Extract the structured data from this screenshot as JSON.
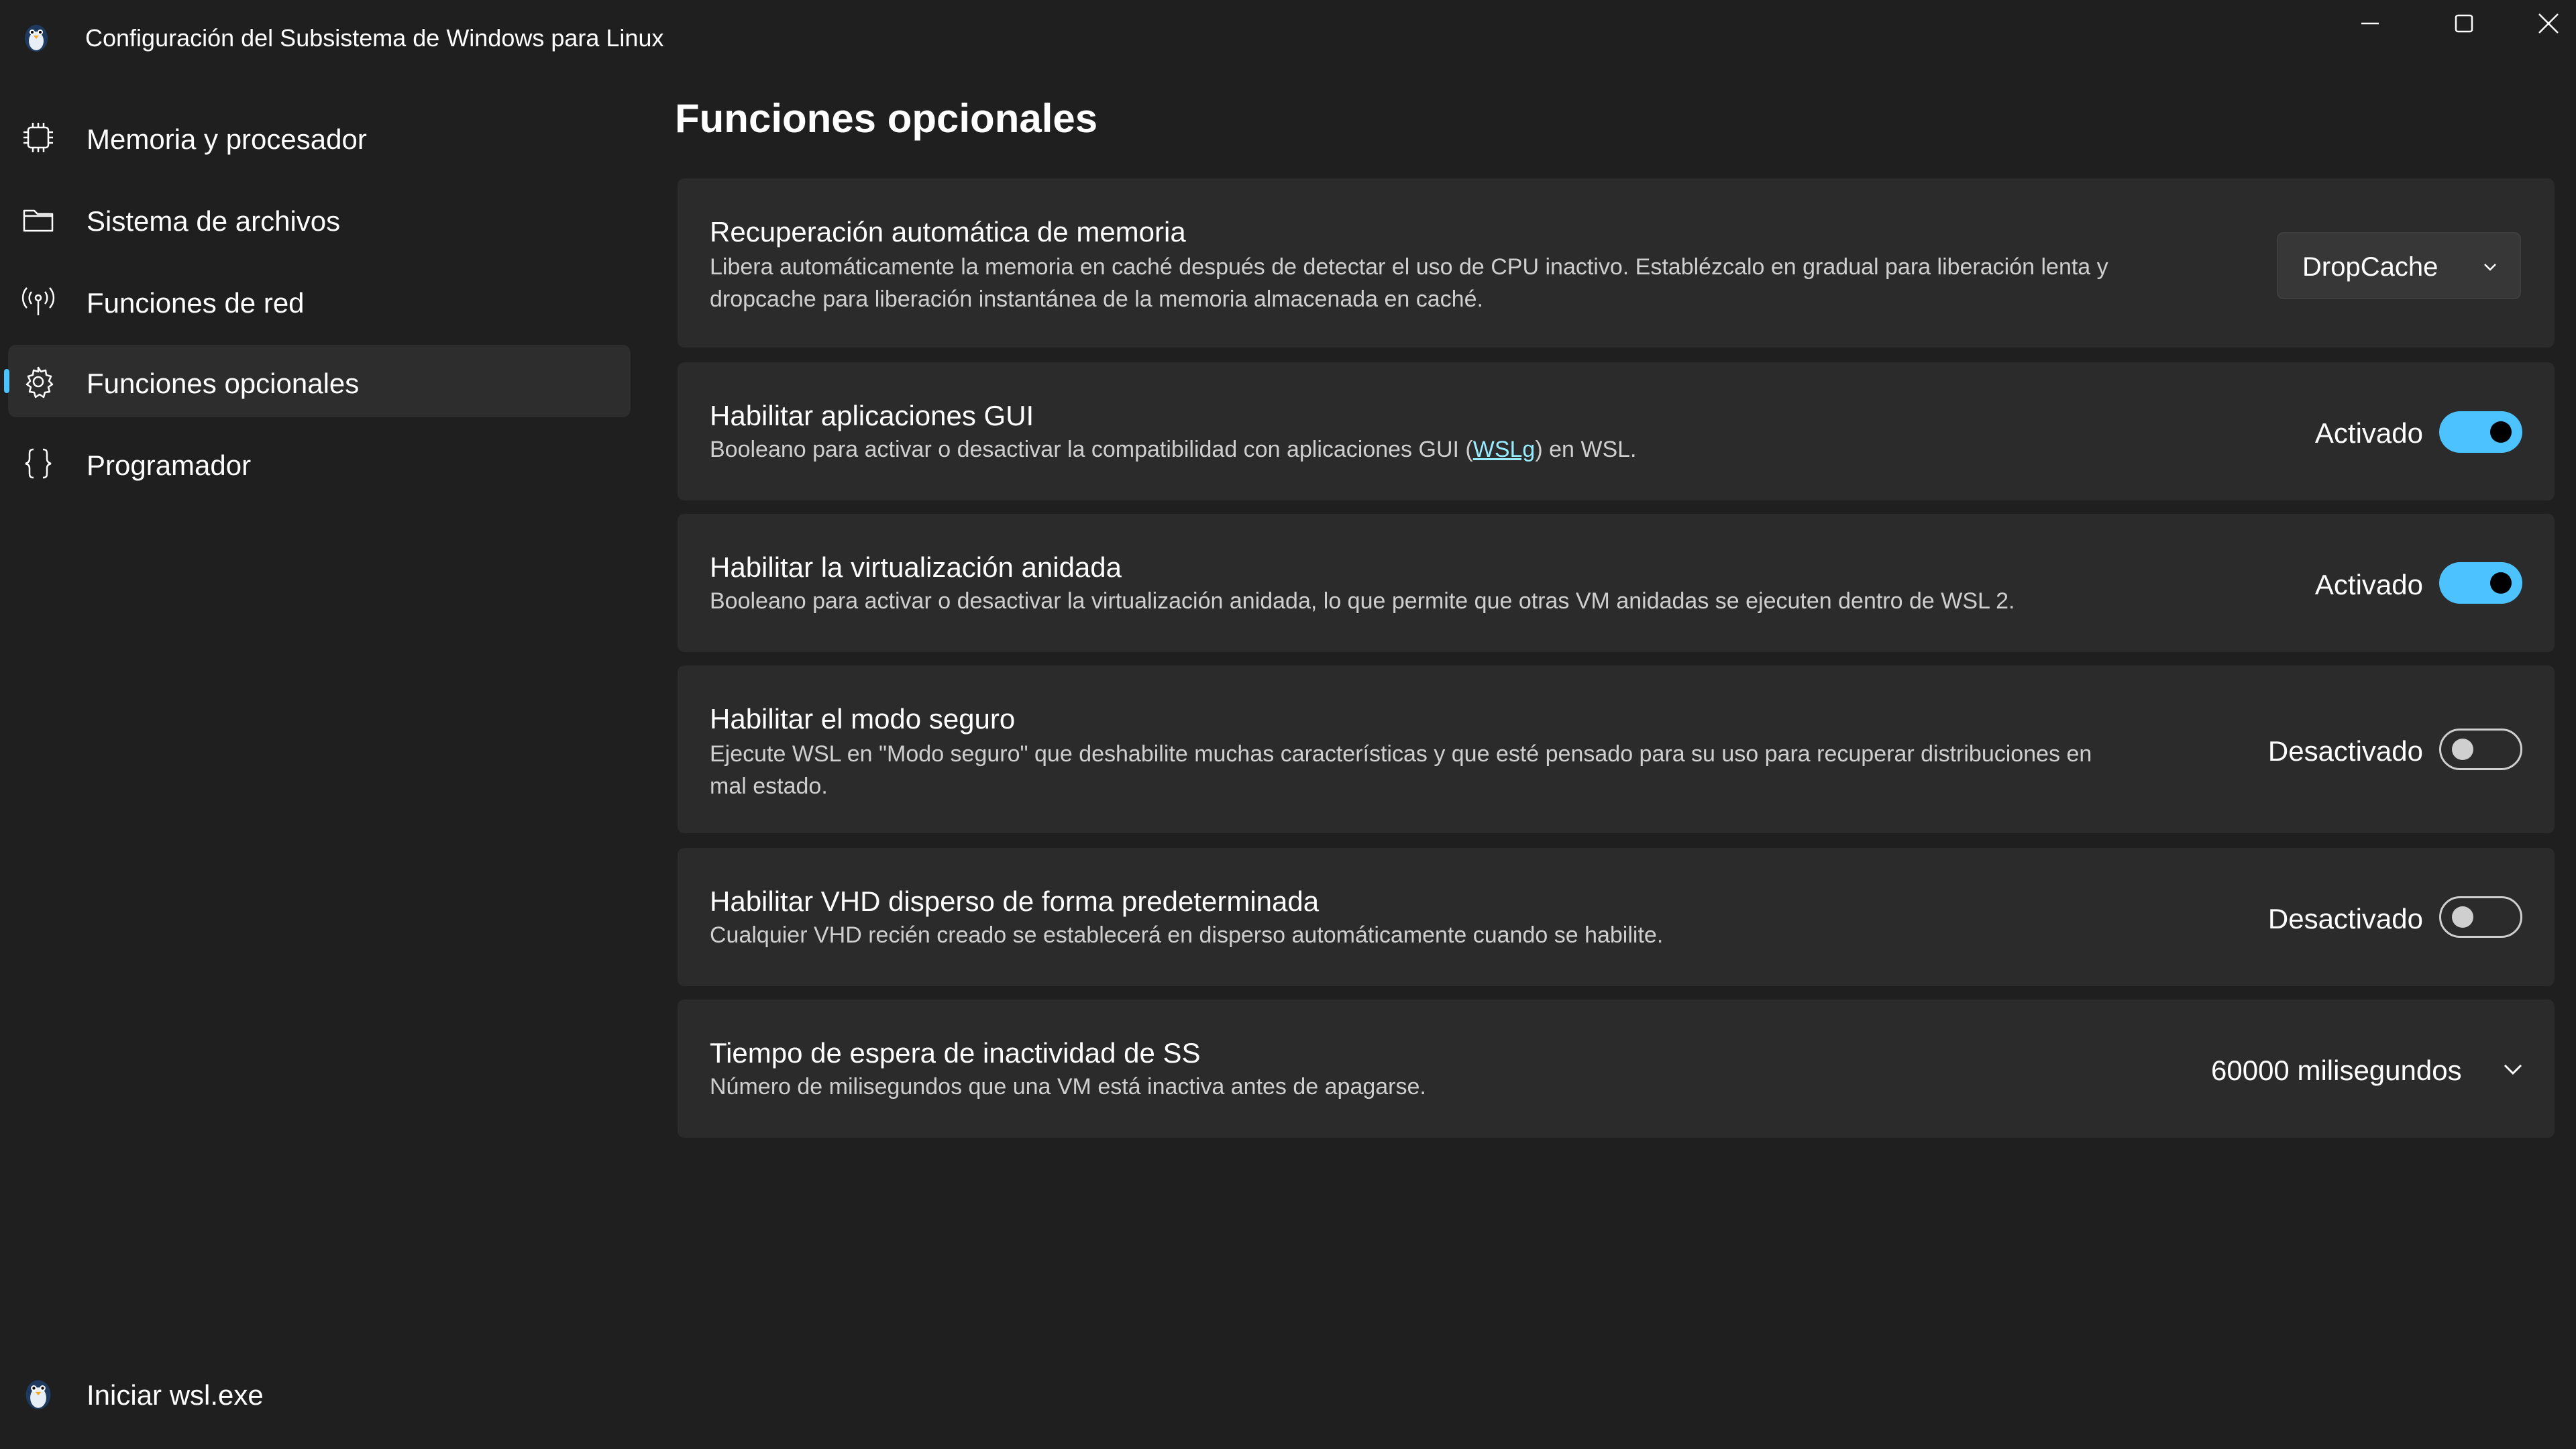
{
  "window": {
    "title": "Configuración del Subsistema de Windows para Linux",
    "icon": "penguin-icon"
  },
  "sidebar": {
    "items": [
      {
        "label": "Memoria y procesador",
        "icon": "chip-icon"
      },
      {
        "label": "Sistema de archivos",
        "icon": "folder-icon"
      },
      {
        "label": "Funciones de red",
        "icon": "network-icon"
      },
      {
        "label": "Funciones opcionales",
        "icon": "gear-icon",
        "selected": true
      },
      {
        "label": "Programador",
        "icon": "braces-icon"
      }
    ],
    "footer": {
      "label": "Iniciar wsl.exe",
      "icon": "penguin-icon"
    }
  },
  "main": {
    "title": "Funciones opcionales",
    "settings": [
      {
        "title": "Recuperación automática de memoria",
        "description_line1": "Libera automáticamente la memoria en caché después de detectar el uso de CPU inactivo. Establézcalo en gradual para liberación lenta y",
        "description_line2": "dropcache para liberación instantánea de la memoria almacenada en caché.",
        "control": "dropdown",
        "value": "DropCache"
      },
      {
        "title": "Habilitar aplicaciones GUI",
        "description_before": "Booleano para activar o desactivar la compatibilidad con aplicaciones GUI (",
        "description_link": "WSLg",
        "description_after": ") en WSL.",
        "control": "toggle",
        "state": "Activado",
        "on": true
      },
      {
        "title": "Habilitar la virtualización anidada",
        "description": "Booleano para activar o desactivar la virtualización anidada, lo que permite que otras VM anidadas se ejecuten dentro de WSL 2.",
        "control": "toggle",
        "state": "Activado",
        "on": true
      },
      {
        "title": "Habilitar el modo seguro",
        "description_line1": "Ejecute WSL en \"Modo seguro\" que deshabilite muchas características y que esté pensado para su uso para recuperar distribuciones en",
        "description_line2": "mal estado.",
        "control": "toggle",
        "state": "Desactivado",
        "on": false
      },
      {
        "title": "Habilitar VHD disperso de forma predeterminada",
        "description": "Cualquier VHD recién creado se establecerá en disperso automáticamente cuando se habilite.",
        "control": "toggle",
        "state": "Desactivado",
        "on": false
      },
      {
        "title": "Tiempo de espera de inactividad de SS",
        "description": "Número de milisegundos que una VM está inactiva antes de apagarse.",
        "control": "select",
        "value": "60000 milisegundos"
      }
    ]
  },
  "colors": {
    "accent": "#4cc2ff",
    "background": "#1f1f1f",
    "card": "#2b2b2b",
    "link": "#99ebff"
  }
}
